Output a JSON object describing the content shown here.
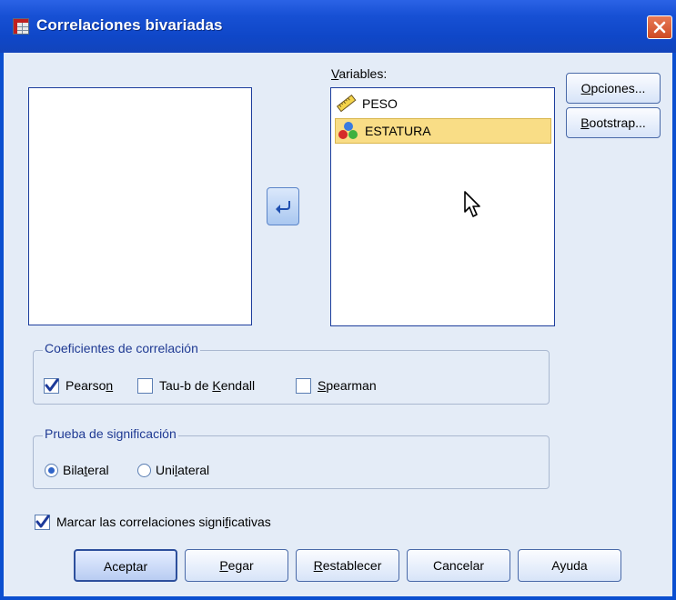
{
  "window": {
    "title": "Correlaciones bivariadas"
  },
  "icons": {
    "title": "spreadsheet-grid-icon",
    "close": "close-icon",
    "arrow": "move-left-arrow-icon",
    "scale": "ruler-icon",
    "nominal": "three-balls-icon",
    "cursor": "mouse-pointer-icon"
  },
  "variables": {
    "label_pre": "",
    "label_ul": "V",
    "label_post": "ariables:",
    "items": [
      {
        "name": "PESO",
        "icon": "ruler-icon"
      },
      {
        "name": "ESTATURA",
        "icon": "three-balls-icon",
        "selected": true
      }
    ]
  },
  "side_buttons": {
    "options": {
      "pre": "",
      "ul": "O",
      "post": "pciones..."
    },
    "bootstrap": {
      "pre": "",
      "ul": "B",
      "post": "ootstrap..."
    }
  },
  "coef_group": {
    "title": "Coeficientes de correlación",
    "pearson": {
      "pre": "Pearso",
      "ul": "n",
      "post": "",
      "checked": true
    },
    "kendall": {
      "pre": "Tau-b de ",
      "ul": "K",
      "post": "endall",
      "checked": false
    },
    "spearman": {
      "pre": "",
      "ul": "S",
      "post": "pearman",
      "checked": false
    }
  },
  "sig_group": {
    "title": "Prueba de significación",
    "bilateral": {
      "pre": "Bila",
      "ul": "t",
      "post": "eral",
      "selected": true
    },
    "unilateral": {
      "pre": "Uni",
      "ul": "l",
      "post": "ateral",
      "selected": false
    }
  },
  "flag": {
    "pre": "Marcar las correlaciones signi",
    "ul": "f",
    "post": "icativas",
    "checked": true
  },
  "buttons": {
    "ok": {
      "pre": "Aceptar",
      "ul": "",
      "post": ""
    },
    "paste": {
      "pre": "",
      "ul": "P",
      "post": "egar"
    },
    "reset": {
      "pre": "",
      "ul": "R",
      "post": "establecer"
    },
    "cancel": {
      "pre": "Cancelar",
      "ul": "",
      "post": ""
    },
    "help": {
      "pre": "Ayuda",
      "ul": "",
      "post": ""
    }
  },
  "colors": {
    "title_bar": "#1750d4",
    "dialog_bg": "#e4ecf7",
    "selection": "#f9dd86",
    "close": "#cd4a24",
    "list_border": "#1c3d9c"
  }
}
